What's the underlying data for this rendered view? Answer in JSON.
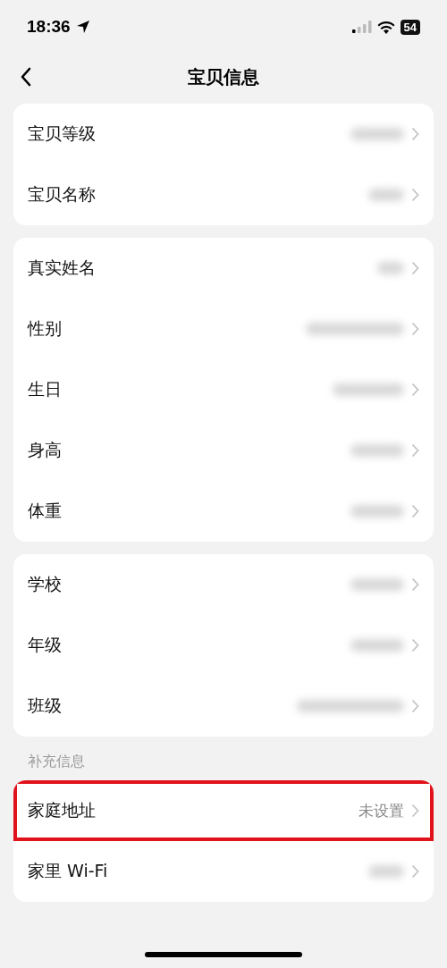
{
  "status_bar": {
    "time": "18:36",
    "battery": "54"
  },
  "header": {
    "title": "宝贝信息"
  },
  "groups": [
    {
      "rows": [
        {
          "label": "宝贝等级",
          "value_blurred": true,
          "highlighted": false
        },
        {
          "label": "宝贝名称",
          "value_blurred": true,
          "highlighted": false
        }
      ]
    },
    {
      "rows": [
        {
          "label": "真实姓名",
          "value_blurred": true,
          "highlighted": false
        },
        {
          "label": "性别",
          "value_blurred": true,
          "highlighted": false
        },
        {
          "label": "生日",
          "value_blurred": true,
          "highlighted": false
        },
        {
          "label": "身高",
          "value_blurred": true,
          "highlighted": false
        },
        {
          "label": "体重",
          "value_blurred": true,
          "highlighted": false
        }
      ]
    },
    {
      "rows": [
        {
          "label": "学校",
          "value_blurred": true,
          "highlighted": false
        },
        {
          "label": "年级",
          "value_blurred": true,
          "highlighted": false
        },
        {
          "label": "班级",
          "value_blurred": true,
          "highlighted": false
        }
      ]
    },
    {
      "title": "补充信息",
      "rows": [
        {
          "label": "家庭地址",
          "value": "未设置",
          "highlighted": true
        },
        {
          "label": "家里 Wi-Fi",
          "value_blurred": true,
          "highlighted": false
        }
      ]
    }
  ]
}
